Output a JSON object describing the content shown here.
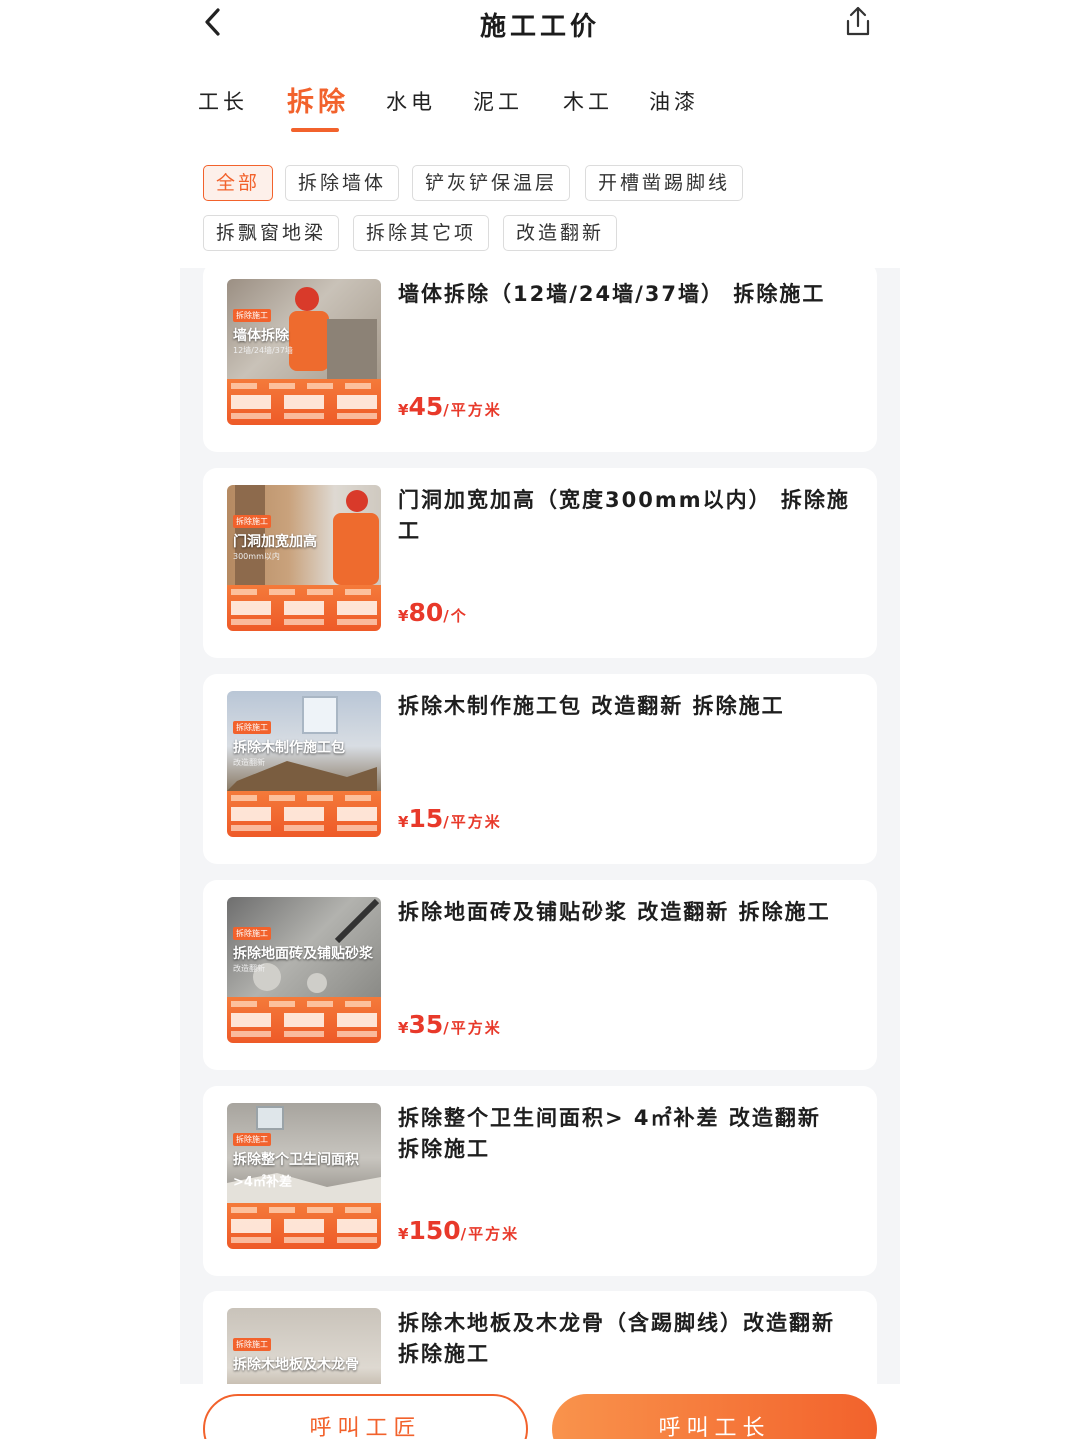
{
  "header": {
    "title": "施工工价",
    "back_icon": "chevron-left-icon",
    "share_icon": "share-icon"
  },
  "tabs": [
    {
      "label": "工长",
      "active": false
    },
    {
      "label": "拆除",
      "active": true
    },
    {
      "label": "水电",
      "active": false
    },
    {
      "label": "泥工",
      "active": false
    },
    {
      "label": "木工",
      "active": false
    },
    {
      "label": "油漆",
      "active": false
    }
  ],
  "filters": [
    {
      "label": "全部",
      "active": true
    },
    {
      "label": "拆除墙体",
      "active": false
    },
    {
      "label": "铲灰铲保温层",
      "active": false
    },
    {
      "label": "开槽凿踢脚线",
      "active": false
    },
    {
      "label": "拆飘窗地梁",
      "active": false
    },
    {
      "label": "拆除其它项",
      "active": false
    },
    {
      "label": "改造翻新",
      "active": false
    }
  ],
  "items": [
    {
      "title": "墙体拆除（12墙/24墙/37墙）  拆除施工",
      "currency": "¥",
      "price": "45",
      "unit": "/平方米",
      "thumb_tag": "拆除施工",
      "thumb_title": "墙体拆除",
      "thumb_sub": "12墙/24墙/37墙"
    },
    {
      "title": "门洞加宽加高（宽度300mm以内）  拆除施工",
      "currency": "¥",
      "price": "80",
      "unit": "/个",
      "thumb_tag": "拆除施工",
      "thumb_title": "门洞加宽加高",
      "thumb_sub": "300mm以内"
    },
    {
      "title": "拆除木制作施工包 改造翻新 拆除施工",
      "currency": "¥",
      "price": "15",
      "unit": "/平方米",
      "thumb_tag": "拆除施工",
      "thumb_title": "拆除木制作施工包",
      "thumb_sub": "改造翻新"
    },
    {
      "title": "拆除地面砖及铺贴砂浆  改造翻新 拆除施工",
      "currency": "¥",
      "price": "35",
      "unit": "/平方米",
      "thumb_tag": "拆除施工",
      "thumb_title": "拆除地面砖及铺贴砂浆",
      "thumb_sub": "改造翻新"
    },
    {
      "title": "拆除整个卫生间面积> 4㎡补差 改造翻新 拆除施工",
      "currency": "¥",
      "price": "150",
      "unit": "/平方米",
      "thumb_tag": "拆除施工",
      "thumb_title": "拆除整个卫生间面积",
      "thumb_sub": ">4㎡补差"
    },
    {
      "title": "拆除木地板及木龙骨（含踢脚线）改造翻新 拆除施工",
      "currency": "",
      "price": "",
      "unit": "",
      "thumb_tag": "拆除施工",
      "thumb_title": "拆除木地板及木龙骨",
      "thumb_sub": ""
    }
  ],
  "bottom": {
    "call_craftsman": "呼叫工匠",
    "call_foreman": "呼叫工长"
  },
  "colors": {
    "accent": "#f2622c",
    "price": "#e8392a",
    "list_bg": "#f4f5f7"
  }
}
